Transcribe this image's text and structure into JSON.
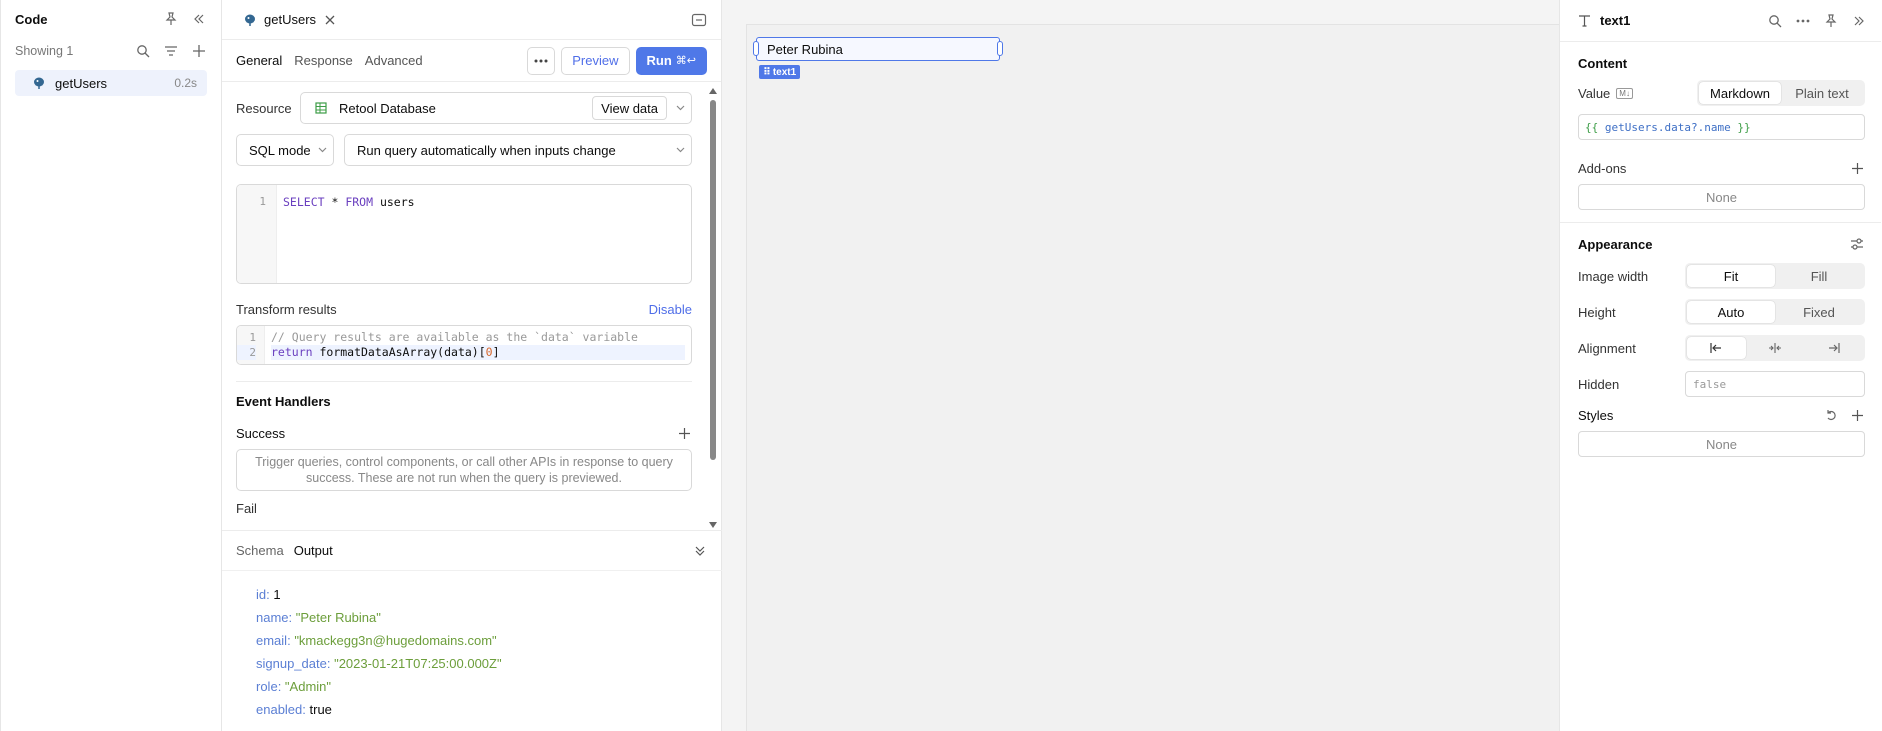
{
  "code_panel": {
    "title": "Code",
    "showing": "Showing 1",
    "query_name": "getUsers",
    "query_time": "0.2s"
  },
  "editor": {
    "tab_name": "getUsers",
    "subtabs": [
      "General",
      "Response",
      "Advanced"
    ],
    "preview_label": "Preview",
    "run_label": "Run",
    "run_shortcut": "⌘↩",
    "resource_label": "Resource",
    "resource_value": "Retool Database",
    "view_data": "View data",
    "mode_value": "SQL mode",
    "trigger_value": "Run query automatically when inputs change",
    "sql": {
      "line": "1",
      "kw1": "SELECT",
      "star": " * ",
      "kw2": "FROM",
      "table": " users"
    },
    "transform_label": "Transform results",
    "disable_label": "Disable",
    "transform_lines": {
      "n1": "1",
      "n2": "2",
      "comment": "// Query results are available as the `data` variable",
      "ret": "return",
      "fn": " formatDataAsArray(data)[",
      "idx": "0",
      "close": "]"
    },
    "event_handlers": "Event Handlers",
    "success_label": "Success",
    "success_hint": "Trigger queries, control components, or call other APIs in response to query success. These are not run when the query is previewed.",
    "failure_peek": "Fail"
  },
  "output": {
    "tabs": [
      "Schema",
      "Output"
    ],
    "rows": [
      {
        "key": "id",
        "value": "1"
      },
      {
        "key": "name",
        "value": "\"Peter Rubina\""
      },
      {
        "key": "email",
        "value": "\"kmackegg3n@hugedomains.com\""
      },
      {
        "key": "signup_date",
        "value": "\"2023-01-21T07:25:00.000Z\""
      },
      {
        "key": "role",
        "value": "\"Admin\""
      },
      {
        "key": "enabled",
        "value": "true"
      }
    ]
  },
  "canvas": {
    "component_text": "Peter Rubina",
    "component_tag": "text1"
  },
  "inspector": {
    "name": "text1",
    "content_title": "Content",
    "value_label": "Value",
    "md_badge": "M↓",
    "markdown_label": "Markdown",
    "plaintext_label": "Plain text",
    "value_open": "{{ ",
    "value_expr": "getUsers.data?.name",
    "value_close": " }}",
    "addons_label": "Add-ons",
    "addons_value": "None",
    "appearance_title": "Appearance",
    "image_width_label": "Image width",
    "fit_label": "Fit",
    "fill_label": "Fill",
    "height_label": "Height",
    "auto_label": "Auto",
    "fixed_label": "Fixed",
    "alignment_label": "Alignment",
    "hidden_label": "Hidden",
    "hidden_placeholder": "false",
    "styles_label": "Styles",
    "styles_value": "None"
  },
  "colors": {
    "accent": "#4f78e8",
    "key": "#5b7fd4",
    "string": "#6c9e3b"
  }
}
